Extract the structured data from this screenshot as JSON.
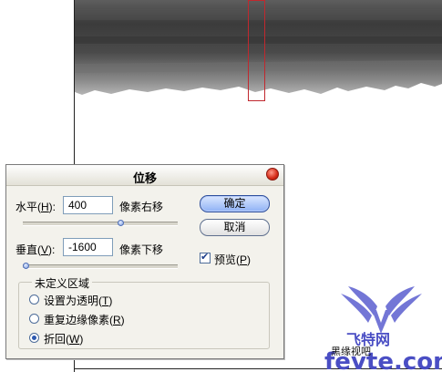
{
  "dialog": {
    "title": "位移",
    "horizontal": {
      "label": "水平(",
      "key": "H",
      "label_end": "):",
      "value": "400",
      "unit": "像素右移",
      "slider_fraction": 0.63
    },
    "vertical": {
      "label": "垂直(",
      "key": "V",
      "label_end": "):",
      "value": "-1600",
      "unit": "像素下移",
      "slider_fraction": 0.0
    },
    "buttons": {
      "ok": "确定",
      "cancel": "取消"
    },
    "preview": {
      "label": "预览(",
      "key": "P",
      "label_end": ")",
      "checked": true
    },
    "undefined_area": {
      "title": "未定义区域",
      "options": [
        {
          "label": "设置为透明(",
          "key": "T",
          "end": ")",
          "selected": false
        },
        {
          "label": "重复边缘像素(",
          "key": "R",
          "end": ")",
          "selected": false
        },
        {
          "label": "折回(",
          "key": "W",
          "end": ")",
          "selected": true
        }
      ]
    }
  },
  "watermark": {
    "brand_cn": "飞特网",
    "domain": "fevte.com",
    "credit": "黑缘视吧"
  },
  "colors": {
    "selection_rect": "#c0282e",
    "ink_dark": "#3a3a3a",
    "watermark_blue": "#4a4ec4"
  }
}
